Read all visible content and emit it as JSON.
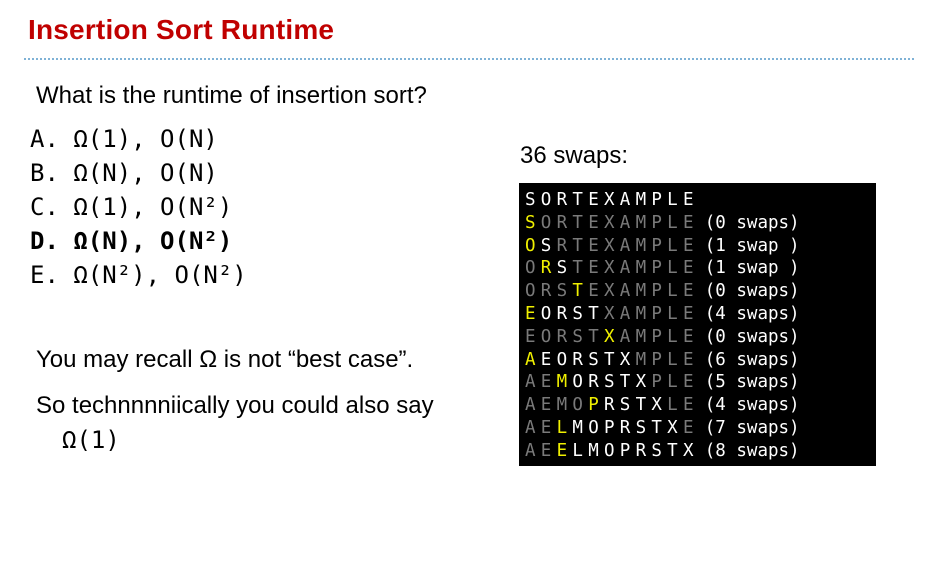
{
  "slide": {
    "title": "Insertion Sort Runtime",
    "question": "What is the runtime of insertion sort?",
    "options": [
      {
        "letter": "A.",
        "text": "Ω(1), O(N)",
        "correct": false
      },
      {
        "letter": "B.",
        "text": "Ω(N), O(N)",
        "correct": false
      },
      {
        "letter": "C.",
        "text": "Ω(1), O(N²)",
        "correct": false
      },
      {
        "letter": "D.",
        "text": "Ω(N), O(N²)",
        "correct": true
      },
      {
        "letter": "E.",
        "text": "Ω(N²), O(N²)",
        "correct": false
      }
    ],
    "note1": "You may recall Ω is not “best case”.",
    "note2": "So technnnniically you could also say",
    "note3": "Ω(1)",
    "swaps_label": "36 swaps:"
  },
  "trace": {
    "colors": {
      "w": "#ffffff",
      "g": "#7a7a7a",
      "y": "#f0f000",
      "gr": "#80d000"
    },
    "rows": [
      {
        "letters": "SORTEXAMPLE",
        "colors": "wwwwwwwwwww",
        "swaps": ""
      },
      {
        "letters": "SORTEXAMPLE",
        "colors": "ygggggggggg",
        "swaps": "(0 swaps)"
      },
      {
        "letters": "OSRTEXAMPLE",
        "colors": "ywggggggggg",
        "swaps": "(1 swap )"
      },
      {
        "letters": "ORSTEXAMPLE",
        "colors": "gywgggggggg",
        "swaps": "(1 swap )"
      },
      {
        "letters": "ORSTEXAMPLE",
        "colors": "gggyggggggg",
        "swaps": "(0 swaps)"
      },
      {
        "letters": "EORSTXAMPLE",
        "colors": "ywwwwgggggg",
        "swaps": "(4 swaps)"
      },
      {
        "letters": "EORSTXAMPLE",
        "colors": "gggggyggggg",
        "swaps": "(0 swaps)"
      },
      {
        "letters": "AEORSTXMPLE",
        "colors": "ywwwwwwgggg",
        "swaps": "(6 swaps)"
      },
      {
        "letters": "AEMORSTXPLE",
        "colors": "ggywwwwwggg",
        "swaps": "(5 swaps)"
      },
      {
        "letters": "AEMOPRSTXLE",
        "colors": "ggggywwwwgg",
        "swaps": "(4 swaps)"
      },
      {
        "letters": "AELMOPRSTXE",
        "colors": "ggywwwwwwwg",
        "swaps": "(7 swaps)"
      },
      {
        "letters": "AEELMOPRSTX",
        "colors": "ggywwwwwwww",
        "swaps": "(8 swaps)"
      }
    ]
  }
}
